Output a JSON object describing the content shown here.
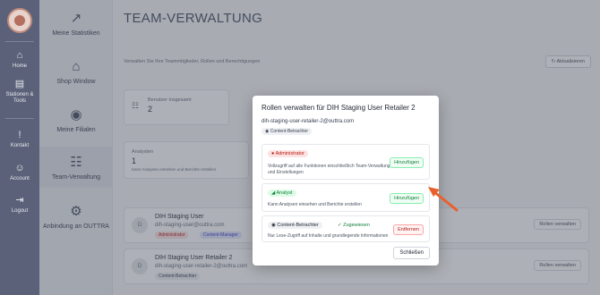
{
  "rail": {
    "items": [
      {
        "label": "Home",
        "icon": "⌂"
      },
      {
        "label": "Stationen &\nTools",
        "icon": "▤"
      },
      {
        "label": "Kontakt",
        "icon": "!"
      },
      {
        "label": "Account",
        "icon": "☺"
      },
      {
        "label": "Logout",
        "icon": "⇥"
      }
    ]
  },
  "sidebar": {
    "items": [
      {
        "label": "Meine Statistiken",
        "icon": "↗"
      },
      {
        "label": "Shop Window",
        "icon": "⌂"
      },
      {
        "label": "Meine Filialen",
        "icon": "◉"
      },
      {
        "label": "Team-Verwaltung",
        "icon": "☷"
      },
      {
        "label": "Anbindung an OUTTRA",
        "icon": "⚙"
      }
    ]
  },
  "main": {
    "title": "TEAM-VERWALTUNG",
    "subtitle": "Verwalten Sie Ihre Teammitglieder, Rollen und Berechtigungen",
    "refresh_label": "Aktualisieren",
    "stats": [
      {
        "label": "Benutzer insgesamt",
        "value": "2"
      },
      {
        "label": "Analysten",
        "value": "1"
      }
    ],
    "stat_caption": "Kann Analysen einsehen und Berichte erstellen",
    "users": [
      {
        "initial": "D",
        "name": "DIH Staging User",
        "email": "dih-staging-user@outtra.com",
        "badges": [
          "Administrator",
          "Content-Manager"
        ],
        "action": "Rollen verwalten"
      },
      {
        "initial": "D",
        "name": "DIH Staging User Retailer 2",
        "email": "dih-staging-user-retailer-2@outtra.com",
        "badges": [
          "Content-Betrachter"
        ],
        "action": "Rollen verwalten"
      }
    ]
  },
  "modal": {
    "title": "Rollen verwalten für DIH Staging User Retailer 2",
    "email": "dih-staging-user-retailer-2@outtra.com",
    "current_badge": "Content-Betrachter",
    "roles": [
      {
        "name": "Administrator",
        "desc": "Vollzugriff auf alle Funktionen einschließlich Team-Verwaltung und Einstellungen",
        "action": "Hinzufügen",
        "assigned": ""
      },
      {
        "name": "Analyst",
        "desc": "Kann Analysen einsehen und Berichte erstellen",
        "action": "Hinzufügen",
        "assigned": ""
      },
      {
        "name": "Content-Betrachter",
        "desc": "Nur Lese-Zugriff auf Inhalte und grundlegende Informationen",
        "action": "Entfernen",
        "assigned": "✓ Zugewiesen"
      }
    ],
    "close_label": "Schließen"
  },
  "colors": {
    "rail": "#5a6178",
    "admin_tag": "#fde2e2",
    "analyst_tag": "#dcfce7",
    "viewer_tag": "#eef0f3",
    "arrow": "#e8612c"
  }
}
